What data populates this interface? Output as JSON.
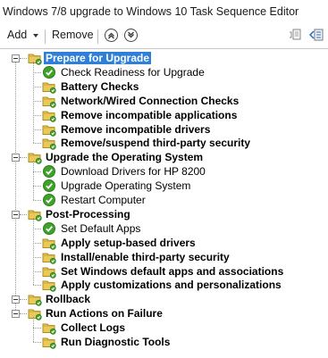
{
  "window": {
    "title": "Windows 7/8 upgrade to Windows 10 Task Sequence Editor"
  },
  "toolbar": {
    "add_label": "Add",
    "remove_label": "Remove"
  },
  "tree": {
    "groups": [
      {
        "label": "Prepare for Upgrade",
        "selected": true,
        "steps": [
          {
            "label": "Check Readiness for Upgrade",
            "bold": false,
            "icon": "check-icon"
          },
          {
            "label": "Battery Checks",
            "bold": true,
            "icon": "folder-icon"
          },
          {
            "label": "Network/Wired Connection Checks",
            "bold": true,
            "icon": "folder-icon"
          },
          {
            "label": "Remove incompatible applications",
            "bold": true,
            "icon": "folder-icon"
          },
          {
            "label": "Remove incompatible drivers",
            "bold": true,
            "icon": "folder-icon"
          },
          {
            "label": "Remove/suspend third-party security",
            "bold": true,
            "icon": "folder-icon"
          }
        ]
      },
      {
        "label": "Upgrade the Operating System",
        "steps": [
          {
            "label": "Download Drivers for HP 8200",
            "bold": false,
            "icon": "check-icon"
          },
          {
            "label": "Upgrade Operating System",
            "bold": false,
            "icon": "check-icon"
          },
          {
            "label": "Restart Computer",
            "bold": false,
            "icon": "check-icon"
          }
        ]
      },
      {
        "label": "Post-Processing",
        "steps": [
          {
            "label": "Set Default Apps",
            "bold": false,
            "icon": "check-icon"
          },
          {
            "label": "Apply setup-based drivers",
            "bold": true,
            "icon": "folder-icon"
          },
          {
            "label": "Install/enable third-party security",
            "bold": true,
            "icon": "folder-icon"
          },
          {
            "label": "Set Windows default apps and associations",
            "bold": true,
            "icon": "folder-icon"
          },
          {
            "label": "Apply customizations and personalizations",
            "bold": true,
            "icon": "folder-icon"
          }
        ]
      },
      {
        "label": "Rollback",
        "steps": []
      },
      {
        "label": "Run Actions on Failure",
        "steps": [
          {
            "label": "Collect Logs",
            "bold": true,
            "icon": "folder-icon"
          },
          {
            "label": "Run Diagnostic Tools",
            "bold": true,
            "icon": "folder-icon"
          }
        ]
      }
    ]
  }
}
